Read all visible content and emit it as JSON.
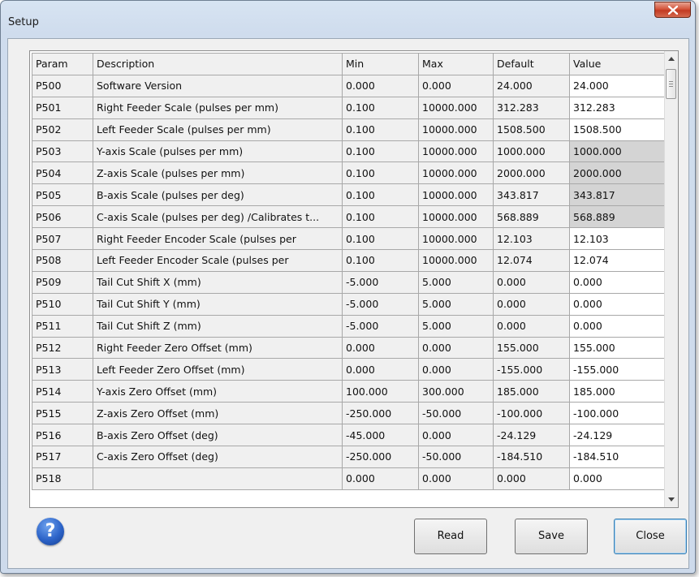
{
  "window": {
    "title": "Setup"
  },
  "table": {
    "columns": [
      "Param",
      "Description",
      "Min",
      "Max",
      "Default",
      "Value"
    ],
    "rows": [
      {
        "param": "P500",
        "desc": "Software Version",
        "min": "0.000",
        "max": "0.000",
        "default": "24.000",
        "value": "24.000",
        "disabled": false
      },
      {
        "param": "P501",
        "desc": "Right Feeder Scale (pulses per mm)",
        "min": "0.100",
        "max": "10000.000",
        "default": "312.283",
        "value": "312.283",
        "disabled": false
      },
      {
        "param": "P502",
        "desc": "Left Feeder Scale (pulses per mm)",
        "min": "0.100",
        "max": "10000.000",
        "default": "1508.500",
        "value": "1508.500",
        "disabled": false
      },
      {
        "param": "P503",
        "desc": "Y-axis Scale (pulses per mm)",
        "min": "0.100",
        "max": "10000.000",
        "default": "1000.000",
        "value": "1000.000",
        "disabled": true
      },
      {
        "param": "P504",
        "desc": "Z-axis Scale (pulses per mm)",
        "min": "0.100",
        "max": "10000.000",
        "default": "2000.000",
        "value": "2000.000",
        "disabled": true
      },
      {
        "param": "P505",
        "desc": "B-axis Scale (pulses per deg)",
        "min": "0.100",
        "max": "10000.000",
        "default": "343.817",
        "value": "343.817",
        "disabled": true
      },
      {
        "param": "P506",
        "desc": "C-axis Scale (pulses per deg) /Calibrates t...",
        "min": "0.100",
        "max": "10000.000",
        "default": "568.889",
        "value": "568.889",
        "disabled": true
      },
      {
        "param": "P507",
        "desc": "Right Feeder Encoder Scale (pulses per",
        "min": "0.100",
        "max": "10000.000",
        "default": "12.103",
        "value": "12.103",
        "disabled": false
      },
      {
        "param": "P508",
        "desc": "Left Feeder Encoder Scale (pulses per",
        "min": "0.100",
        "max": "10000.000",
        "default": "12.074",
        "value": "12.074",
        "disabled": false
      },
      {
        "param": "P509",
        "desc": "Tail Cut Shift X (mm)",
        "min": "-5.000",
        "max": "5.000",
        "default": "0.000",
        "value": "0.000",
        "disabled": false
      },
      {
        "param": "P510",
        "desc": "Tail Cut Shift Y (mm)",
        "min": "-5.000",
        "max": "5.000",
        "default": "0.000",
        "value": "0.000",
        "disabled": false
      },
      {
        "param": "P511",
        "desc": "Tail Cut Shift Z (mm)",
        "min": "-5.000",
        "max": "5.000",
        "default": "0.000",
        "value": "0.000",
        "disabled": false
      },
      {
        "param": "P512",
        "desc": "Right Feeder Zero Offset (mm)",
        "min": "0.000",
        "max": "0.000",
        "default": "155.000",
        "value": "155.000",
        "disabled": false
      },
      {
        "param": "P513",
        "desc": "Left Feeder Zero Offset (mm)",
        "min": "0.000",
        "max": "0.000",
        "default": "-155.000",
        "value": "-155.000",
        "disabled": false
      },
      {
        "param": "P514",
        "desc": "Y-axis Zero Offset (mm)",
        "min": "100.000",
        "max": "300.000",
        "default": "185.000",
        "value": "185.000",
        "disabled": false
      },
      {
        "param": "P515",
        "desc": "Z-axis Zero Offset (mm)",
        "min": "-250.000",
        "max": "-50.000",
        "default": "-100.000",
        "value": "-100.000",
        "disabled": false
      },
      {
        "param": "P516",
        "desc": "B-axis Zero Offset (deg)",
        "min": "-45.000",
        "max": "0.000",
        "default": "-24.129",
        "value": "-24.129",
        "disabled": false
      },
      {
        "param": "P517",
        "desc": "C-axis Zero Offset (deg)",
        "min": "-250.000",
        "max": "-50.000",
        "default": "-184.510",
        "value": "-184.510",
        "disabled": false
      },
      {
        "param": "P518",
        "desc": "",
        "min": "0.000",
        "max": "0.000",
        "default": "0.000",
        "value": "0.000",
        "disabled": false
      }
    ]
  },
  "buttons": {
    "read": "Read",
    "save": "Save",
    "close": "Close"
  },
  "icons": {
    "help": "help-icon",
    "window_close": "close-icon"
  },
  "colors": {
    "disabled_value_bg": "#d4d4d4",
    "close_button": "#c8432a"
  }
}
